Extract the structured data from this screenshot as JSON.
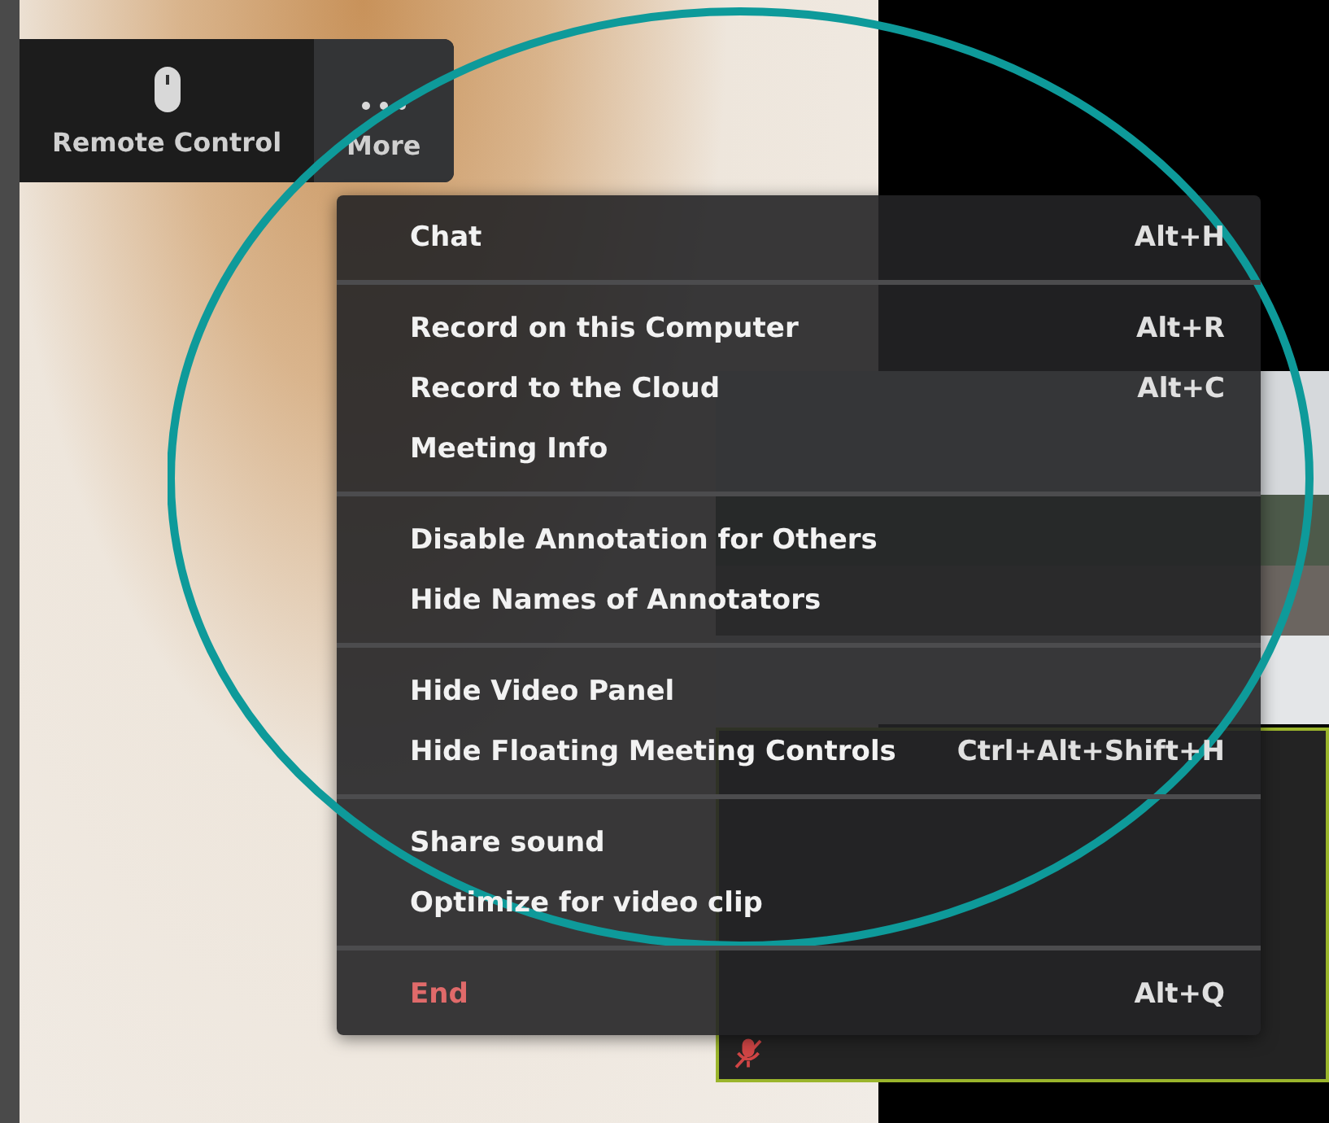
{
  "toolbar": [
    {
      "label": "Remote Control",
      "selected": false
    },
    {
      "label": "More",
      "selected": true
    }
  ],
  "video_tiles": [
    {
      "kind": "camera"
    },
    {
      "kind": "avatar",
      "muted": true
    }
  ],
  "menu": {
    "sections": [
      [
        {
          "label": "Chat",
          "shortcut": "Alt+H",
          "kind": "normal"
        }
      ],
      [
        {
          "label": "Record on this Computer",
          "shortcut": "Alt+R",
          "kind": "normal"
        },
        {
          "label": "Record to the Cloud",
          "shortcut": "Alt+C",
          "kind": "normal"
        },
        {
          "label": "Meeting Info",
          "kind": "normal"
        }
      ],
      [
        {
          "label": "Disable Annotation for Others",
          "kind": "normal"
        },
        {
          "label": "Hide Names of Annotators",
          "kind": "normal"
        }
      ],
      [
        {
          "label": "Hide Video Panel",
          "kind": "normal"
        },
        {
          "label": "Hide Floating Meeting Controls",
          "shortcut": "Ctrl+Alt+Shift+H",
          "kind": "normal"
        }
      ],
      [
        {
          "label": "Share sound",
          "kind": "normal"
        },
        {
          "label": "Optimize for video clip",
          "kind": "normal"
        }
      ],
      [
        {
          "label": "End",
          "shortcut": "Alt+Q",
          "kind": "danger"
        }
      ]
    ]
  }
}
